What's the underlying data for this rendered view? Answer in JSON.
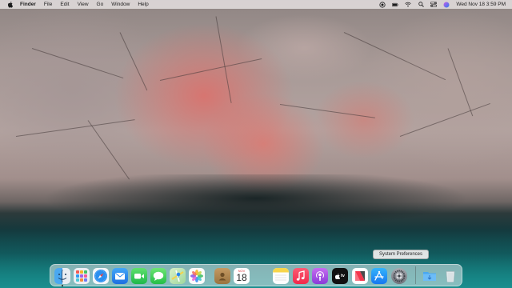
{
  "menubar": {
    "apple_icon": "apple-logo-icon",
    "app_name": "Finder",
    "items": [
      "File",
      "Edit",
      "View",
      "Go",
      "Window",
      "Help"
    ],
    "status_icons": [
      "screen-recording-icon",
      "battery-icon",
      "wifi-icon",
      "spotlight-search-icon",
      "control-center-icon",
      "siri-icon"
    ],
    "clock": "Wed Nov 18  3:59 PM"
  },
  "tooltip": {
    "text": "System Preferences"
  },
  "dock": {
    "apps": [
      {
        "name": "Finder",
        "icon": "finder-icon",
        "running": true
      },
      {
        "name": "Launchpad",
        "icon": "launchpad-icon"
      },
      {
        "name": "Safari",
        "icon": "safari-icon"
      },
      {
        "name": "Mail",
        "icon": "mail-icon"
      },
      {
        "name": "FaceTime",
        "icon": "facetime-icon"
      },
      {
        "name": "Messages",
        "icon": "messages-icon"
      },
      {
        "name": "Maps",
        "icon": "maps-icon"
      },
      {
        "name": "Photos",
        "icon": "photos-icon"
      },
      {
        "name": "Contacts",
        "icon": "contacts-icon"
      },
      {
        "name": "Calendar",
        "icon": "calendar-icon",
        "month": "NOV",
        "day": "18"
      },
      {
        "name": "Notes",
        "icon": "notes-icon"
      },
      {
        "name": "Music",
        "icon": "music-icon"
      },
      {
        "name": "Podcasts",
        "icon": "podcasts-icon"
      },
      {
        "name": "TV",
        "icon": "apple-tv-icon",
        "label": "tv"
      },
      {
        "name": "News",
        "icon": "news-icon"
      },
      {
        "name": "App Store",
        "icon": "app-store-icon"
      },
      {
        "name": "System Preferences",
        "icon": "system-preferences-icon"
      },
      {
        "name": "Downloads",
        "icon": "downloads-folder-icon"
      },
      {
        "name": "Trash",
        "icon": "trash-icon"
      }
    ]
  }
}
